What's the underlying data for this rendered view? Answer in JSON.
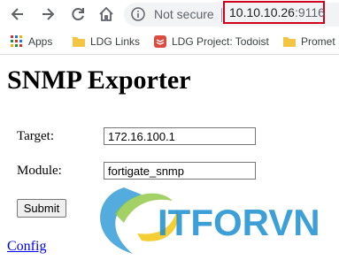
{
  "browser": {
    "security_label": "Not secure",
    "url_host": "10.10.10.26",
    "url_port": ":9116"
  },
  "bookmarks": [
    {
      "label": "Apps",
      "icon": "apps-grid-icon"
    },
    {
      "label": "LDG Links",
      "icon": "folder-icon"
    },
    {
      "label": "LDG Project: Todoist",
      "icon": "todoist-icon"
    },
    {
      "label": "Promet",
      "icon": "folder-icon"
    }
  ],
  "page": {
    "title": "SNMP Exporter",
    "target_label": "Target:",
    "target_value": "172.16.100.1",
    "module_label": "Module:",
    "module_value": "fortigate_snmp",
    "submit_label": "Submit",
    "config_link": "Config"
  },
  "watermark": {
    "text": "ITFORVN",
    "colors": {
      "blue": "#1b8fd1",
      "green": "#8cc63f",
      "yellow": "#f2c511"
    }
  }
}
